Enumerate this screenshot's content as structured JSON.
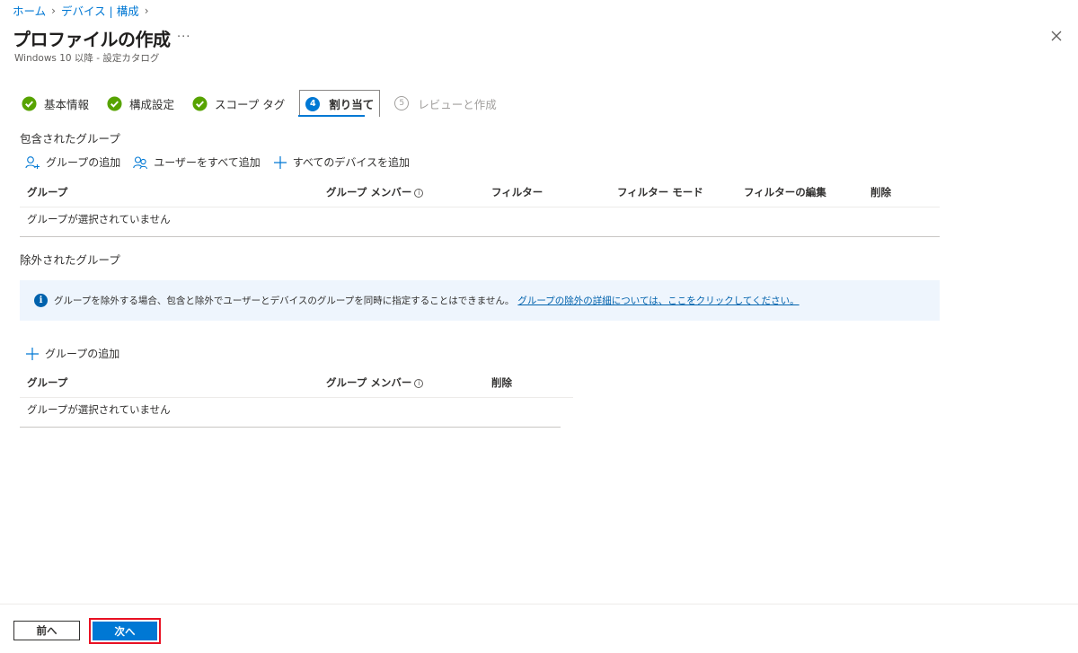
{
  "breadcrumb": [
    "ホーム",
    "デバイス | 構成"
  ],
  "page": {
    "title": "プロファイルの作成",
    "more": "···",
    "subtitle": "Windows 10 以降 - 設定カタログ"
  },
  "steps": [
    {
      "label": "基本情報",
      "state": "done"
    },
    {
      "label": "構成設定",
      "state": "done"
    },
    {
      "label": "スコープ タグ",
      "state": "done"
    },
    {
      "label": "割り当て",
      "number": "4",
      "state": "active"
    },
    {
      "label": "レビューと作成",
      "number": "5",
      "state": "disabled"
    }
  ],
  "included": {
    "title": "包含されたグループ",
    "commands": {
      "add_group": "グループの追加",
      "add_all_users": "ユーザーをすべて追加",
      "add_all_devices": "すべてのデバイスを追加"
    },
    "columns": {
      "group": "グループ",
      "members": "グループ メンバー",
      "filter": "フィルター",
      "filter_mode": "フィルター モード",
      "filter_edit": "フィルターの編集",
      "delete": "削除"
    },
    "empty": "グループが選択されていません"
  },
  "excluded": {
    "title": "除外されたグループ",
    "info_text": "グループを除外する場合、包含と除外でユーザーとデバイスのグループを同時に指定することはできません。",
    "info_link": "グループの除外の詳細については、ここをクリックしてください。",
    "add_group": "グループの追加",
    "columns": {
      "group": "グループ",
      "members": "グループ メンバー",
      "delete": "削除"
    },
    "empty": "グループが選択されていません"
  },
  "footer": {
    "prev": "前へ",
    "next": "次へ"
  },
  "colors": {
    "accent": "#0078d4",
    "success": "#57a300",
    "highlight": "#e81123"
  }
}
